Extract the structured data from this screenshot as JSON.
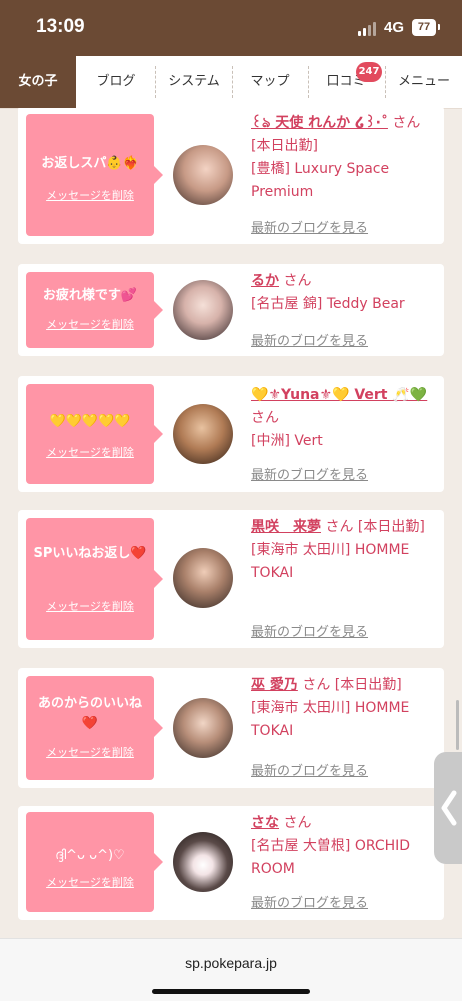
{
  "status_bar": {
    "time": "13:09",
    "network": "4G",
    "battery": "77"
  },
  "nav": {
    "tabs": [
      "女の子",
      "ブログ",
      "システム",
      "マップ",
      "口コミ",
      "メニュー"
    ],
    "active_tab": "女の子",
    "badge": "247"
  },
  "messages": [
    {
      "message": "お返しスパ👶❤️‍🔥",
      "delete_label": "メッセージを削除",
      "name": "꒰ঌ 天使 れんか ໒꒱·˚",
      "san": "さん",
      "info": "[本日出勤]\n[豊橋] Luxury Space Premium",
      "blog_link": "最新のブログを見る"
    },
    {
      "message": "お疲れ様です💕",
      "delete_label": "メッセージを削除",
      "name": "るか",
      "san": "さん",
      "info": "[名古屋 錦] Teddy Bear",
      "blog_link": "最新のブログを見る"
    },
    {
      "message": "💛💛💛💛💛",
      "delete_label": "メッセージを削除",
      "name": "💛⚜Yuna⚜💛 Vert 🥂💚",
      "san": "さん",
      "info": "[中洲] Vert",
      "blog_link": "最新のブログを見る"
    },
    {
      "message": "SPいいねお返し❤️",
      "delete_label": "メッセージを削除",
      "name": "黒咲　来夢",
      "san": "さん",
      "info": "[本日出勤]\n[東海市 太田川] HOMME TOKAI",
      "blog_link": "最新のブログを見る"
    },
    {
      "message": "あのからのいいね❤️",
      "delete_label": "メッセージを削除",
      "name": "巫 愛乃",
      "san": "さん",
      "info": "[本日出勤]\n[東海市 太田川] HOMME TOKAI",
      "blog_link": "最新のブログを見る"
    },
    {
      "message": "ദ്ദി^ᴗ ᴗ^)♡",
      "delete_label": "メッセージを削除",
      "name": "さな",
      "san": "さん",
      "info": "[名古屋 大曽根] ORCHID ROOM",
      "blog_link": "最新のブログを見る"
    }
  ],
  "url_bar": {
    "url": "sp.pokepara.jp"
  }
}
